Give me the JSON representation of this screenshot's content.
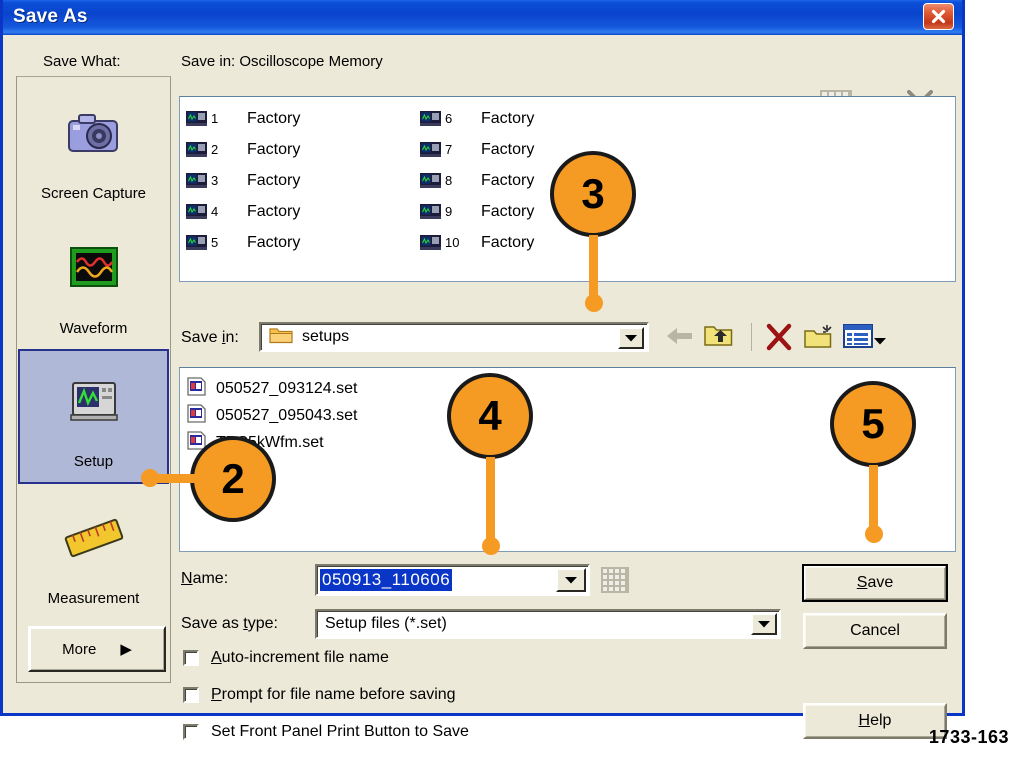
{
  "window": {
    "title": "Save As",
    "close_icon": "close-icon"
  },
  "sidebar": {
    "header": "Save What:",
    "items": [
      {
        "label": "Screen Capture",
        "icon": "camera-icon",
        "selected": false
      },
      {
        "label": "Waveform",
        "icon": "waveform-icon",
        "selected": false
      },
      {
        "label": "Setup",
        "icon": "oscilloscope-setup-icon",
        "selected": true
      },
      {
        "label": "Measurement",
        "icon": "ruler-icon",
        "selected": false
      }
    ],
    "more_label": "More",
    "more_arrow": "▶"
  },
  "memory_panel": {
    "header": "Save in: Oscilloscope Memory",
    "grid_icon": "keypad-grid-icon",
    "delete_icon": "delete-x-icon",
    "entries": [
      {
        "num": "1",
        "name": "Factory"
      },
      {
        "num": "2",
        "name": "Factory"
      },
      {
        "num": "3",
        "name": "Factory"
      },
      {
        "num": "4",
        "name": "Factory"
      },
      {
        "num": "5",
        "name": "Factory"
      },
      {
        "num": "6",
        "name": "Factory"
      },
      {
        "num": "7",
        "name": "Factory"
      },
      {
        "num": "8",
        "name": "Factory"
      },
      {
        "num": "9",
        "name": "Factory"
      },
      {
        "num": "10",
        "name": "Factory"
      }
    ]
  },
  "savein": {
    "label_pre": "Save ",
    "label_key": "i",
    "label_post": "n:",
    "value": "setups",
    "folder_icon": "folder-icon",
    "dropdown_icon": "chevron-down-icon",
    "toolbar": [
      {
        "name": "back-button",
        "icon": "back-arrow-icon"
      },
      {
        "name": "up-folder-button",
        "icon": "up-folder-icon"
      },
      {
        "name": "delete-button",
        "icon": "delete-x-icon"
      },
      {
        "name": "new-folder-button",
        "icon": "new-folder-icon"
      },
      {
        "name": "views-button",
        "icon": "views-list-icon"
      }
    ]
  },
  "files": [
    {
      "name": "050527_093124.set",
      "icon": "set-file-icon"
    },
    {
      "name": "050527_095043.set",
      "icon": "set-file-icon"
    },
    {
      "name": "TDS5kWfm.set",
      "icon": "set-file-icon"
    }
  ],
  "name_field": {
    "label_key": "N",
    "label_post": "ame:",
    "value": "050913_110606",
    "dropdown_icon": "chevron-down-icon",
    "keypad_icon": "keypad-grid-icon"
  },
  "type_field": {
    "label_pre": "Save as ",
    "label_key": "t",
    "label_post": "ype:",
    "value": "Setup files (*.set)",
    "dropdown_icon": "chevron-down-icon"
  },
  "checkboxes": [
    {
      "key": "A",
      "rest": "uto-increment file name",
      "checked": false
    },
    {
      "key": "P",
      "rest": "rompt for file name before saving",
      "checked": false
    },
    {
      "key": "",
      "rest": "Set Front Panel Print Button to Save",
      "checked": false
    }
  ],
  "buttons": {
    "save": {
      "key": "S",
      "rest": "ave",
      "default": true
    },
    "cancel": {
      "key": "",
      "rest": "Cancel",
      "default": false
    },
    "help": {
      "key": "H",
      "rest": "elp",
      "default": false
    }
  },
  "callouts": [
    {
      "number": "2",
      "target": "setup-sidebar-item"
    },
    {
      "number": "3",
      "target": "savein-dropdown"
    },
    {
      "number": "4",
      "target": "name-field"
    },
    {
      "number": "5",
      "target": "save-button"
    }
  ],
  "caption": "1733-163",
  "colors": {
    "titlebar_blue": "#0a44cd",
    "selection_blue": "#0a36c8",
    "callout_orange": "#f59a23",
    "dialog_face": "#ece9d8",
    "selected_item": "#b0b8d8"
  }
}
